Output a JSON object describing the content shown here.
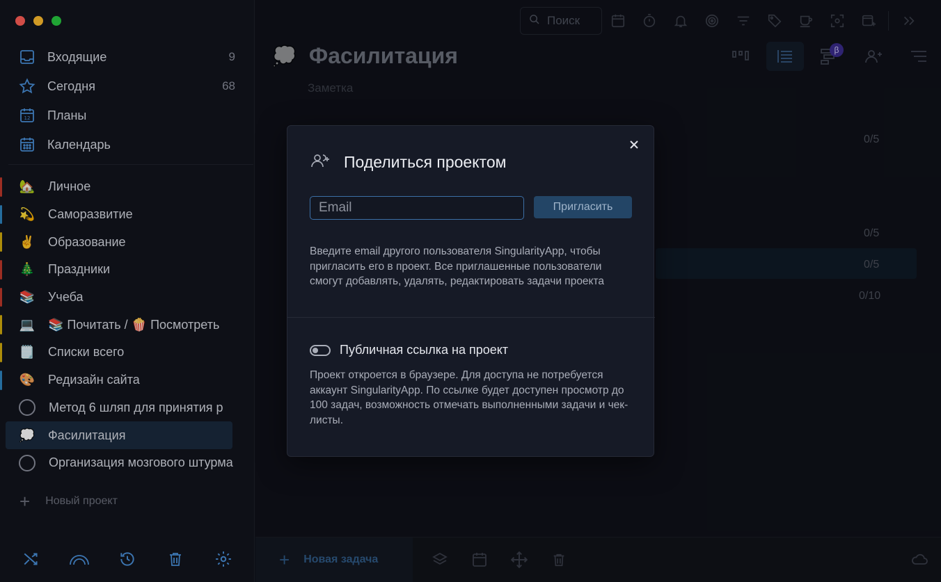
{
  "sidebar": {
    "nav": [
      {
        "label": "Входящие",
        "count": "9",
        "icon": "inbox-icon"
      },
      {
        "label": "Сегодня",
        "count": "68",
        "icon": "star-icon"
      },
      {
        "label": "Планы",
        "count": "",
        "icon": "calendar-12-icon"
      },
      {
        "label": "Календарь",
        "count": "",
        "icon": "calendar-grid-icon"
      }
    ],
    "projects": [
      {
        "label": "Личное",
        "emoji": "🏡",
        "bar": "#c0392b"
      },
      {
        "label": "Саморазвитие",
        "emoji": "💫",
        "bar": "#2e86c1"
      },
      {
        "label": "Образование",
        "emoji": "✌️",
        "bar": "#d4ac0d"
      },
      {
        "label": "Праздники",
        "emoji": "🎄",
        "bar": "#c0392b"
      },
      {
        "label": "Учеба",
        "emoji": "📚",
        "bar": "#c0392b"
      },
      {
        "label": "📚 Почитать / 🍿 Посмотреть",
        "emoji": "💻",
        "bar": "#d4ac0d"
      },
      {
        "label": "Списки всего",
        "emoji": "🗒️",
        "bar": "#d4ac0d"
      },
      {
        "label": "Редизайн сайта",
        "emoji": "🎨",
        "bar": "#2e86c1"
      },
      {
        "label": "Метод 6 шляп для принятия р",
        "emoji": "",
        "bar": ""
      },
      {
        "label": "Фасилитация",
        "emoji": "💭",
        "bar": "#7f8c8d"
      },
      {
        "label": "Организация мозгового штурма",
        "emoji": "",
        "bar": ""
      }
    ],
    "new_project": "Новый проект"
  },
  "toolbar": {
    "search_placeholder": "Поиск"
  },
  "project": {
    "title": "Фасилитация",
    "note": "Заметка",
    "emoji": "💭",
    "beta_badge": "β",
    "counts": [
      "0/5",
      "0/5",
      "0/5",
      "0/10"
    ]
  },
  "bottom": {
    "new_task": "Новая задача"
  },
  "modal": {
    "title": "Поделиться проектом",
    "email_placeholder": "Email",
    "invite_label": "Пригласить",
    "description": "Введите email другого пользователя SingularityApp, чтобы пригласить его в проект. Все приглашенные пользователи смогут добавлять, удалять, редактировать задачи проекта",
    "public_link_label": "Публичная ссылка на проект",
    "public_link_enabled": false,
    "public_description": "Проект откроется в браузере. Для доступа не потребуется аккаунт SingularityApp. По ссылке будет доступен просмотр до 100 задач, возможность отмечать выполненными задачи и чек-листы."
  },
  "colors": {
    "accent": "#4a90d9",
    "invite_button": "#234566",
    "email_border": "#3c6fa6"
  }
}
